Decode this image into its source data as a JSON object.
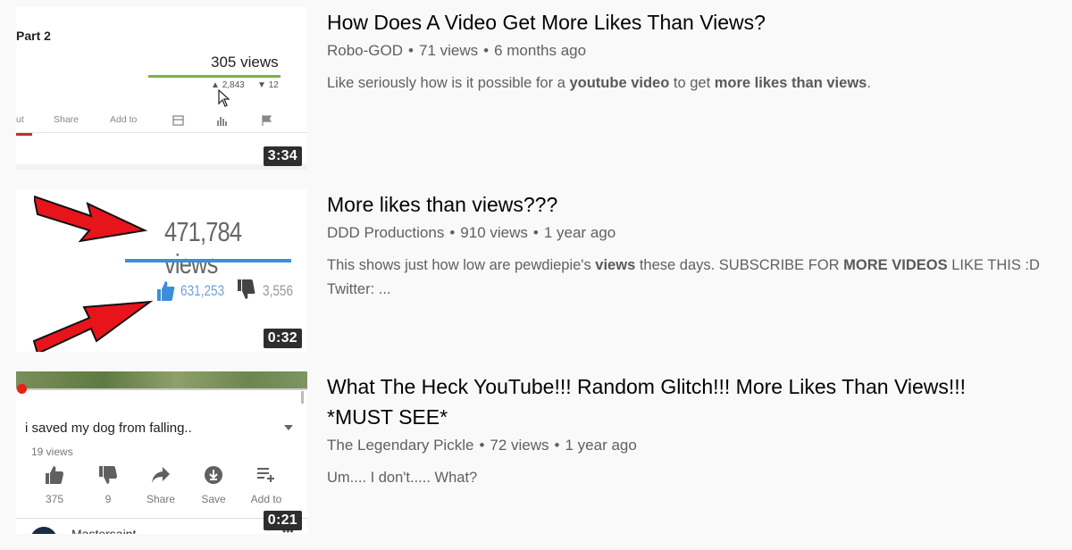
{
  "results": [
    {
      "title": "How Does A Video Get More Likes Than Views?",
      "channel": "Robo-GOD",
      "views": "71 views",
      "age": "6 months ago",
      "duration": "3:34",
      "description": {
        "pre": "Like seriously how is it possible for a ",
        "b1": "youtube video",
        "mid": " to get ",
        "b2": "more likes than views",
        "post": "."
      },
      "thumb": {
        "part": "Part 2",
        "views": "305 views",
        "likes": "2,843",
        "dislikes": "12",
        "actions": [
          "ut",
          "Share",
          "Add to"
        ]
      }
    },
    {
      "title": "More likes than views???",
      "channel": "DDD Productions",
      "views": "910 views",
      "age": "1 year ago",
      "duration": "0:32",
      "description": {
        "pre": "This shows just how low are pewdiepie's ",
        "b1": "views",
        "mid": " these days. SUBSCRIBE FOR ",
        "b2": "MORE VIDEOS",
        "post": " LIKE THIS :D Twitter: ..."
      },
      "thumb": {
        "views": "471,784 views",
        "likes": "631,253",
        "dislikes": "3,556"
      }
    },
    {
      "title_line1": "What The Heck YouTube!!! Random Glitch!!! More Likes Than Views!!!",
      "title_line2": "*MUST SEE*",
      "channel": "The Legendary Pickle",
      "views": "72 views",
      "age": "1 year ago",
      "duration": "0:21",
      "description": "Um.... I don't..... What?",
      "thumb": {
        "video_title": "i saved my dog from falling..",
        "views": "19 views",
        "actions": [
          "375",
          "9",
          "Share",
          "Save",
          "Add to"
        ],
        "channel": "Mastersaint",
        "more": "•••"
      }
    }
  ],
  "separator": "•"
}
